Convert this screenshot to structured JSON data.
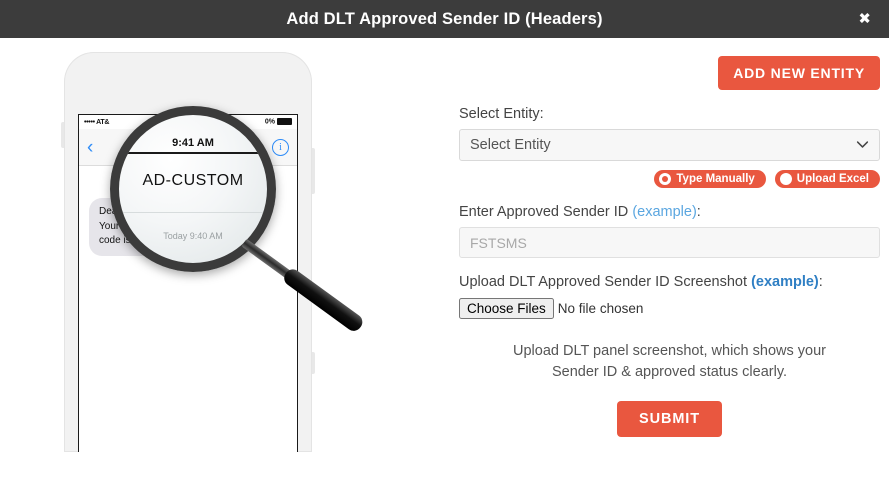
{
  "modal": {
    "title": "Add DLT Approved Sender ID (Headers)",
    "close_icon": "close-icon",
    "close_glyph": "✖",
    "header_bg": "#3c3c3c",
    "accent_color": "#e9573f"
  },
  "illustration": {
    "phone": {
      "status_bar": {
        "carrier": "••••• AT&",
        "battery_label": "0%"
      },
      "nav": {
        "back_glyph": "‹",
        "title": "AD-CUSTOM",
        "info_glyph": "i"
      },
      "message_time": "Today 9:40 AM",
      "message_body": "Dear user,\nYour OTP verification\ncode is: 123456"
    },
    "magnifier": {
      "time": "9:41 AM",
      "sender_id": "AD-CUSTOM",
      "today_label": "Today 9:40 AM"
    }
  },
  "form": {
    "add_new_entity_label": "ADD NEW ENTITY",
    "select_entity_label": "Select Entity:",
    "entity_select": {
      "selected": "Select Entity",
      "options": [
        "Select Entity"
      ]
    },
    "mode_options": [
      {
        "label": "Type Manually",
        "selected": true
      },
      {
        "label": "Upload Excel",
        "selected": false
      }
    ],
    "sender_id_label": "Enter Approved Sender ID",
    "sender_id_example": "(example)",
    "sender_id_label_suffix": ":",
    "sender_id_placeholder": "FSTSMS",
    "sender_id_value": "",
    "upload_label": "Upload DLT Approved Sender ID Screenshot",
    "upload_example": "(example)",
    "upload_label_suffix": ":",
    "file_button_label": "Choose Files",
    "file_status": "No file chosen",
    "hint_line1": "Upload DLT panel screenshot, which shows your",
    "hint_line2": "Sender ID & approved status clearly.",
    "submit_label": "SUBMIT"
  }
}
